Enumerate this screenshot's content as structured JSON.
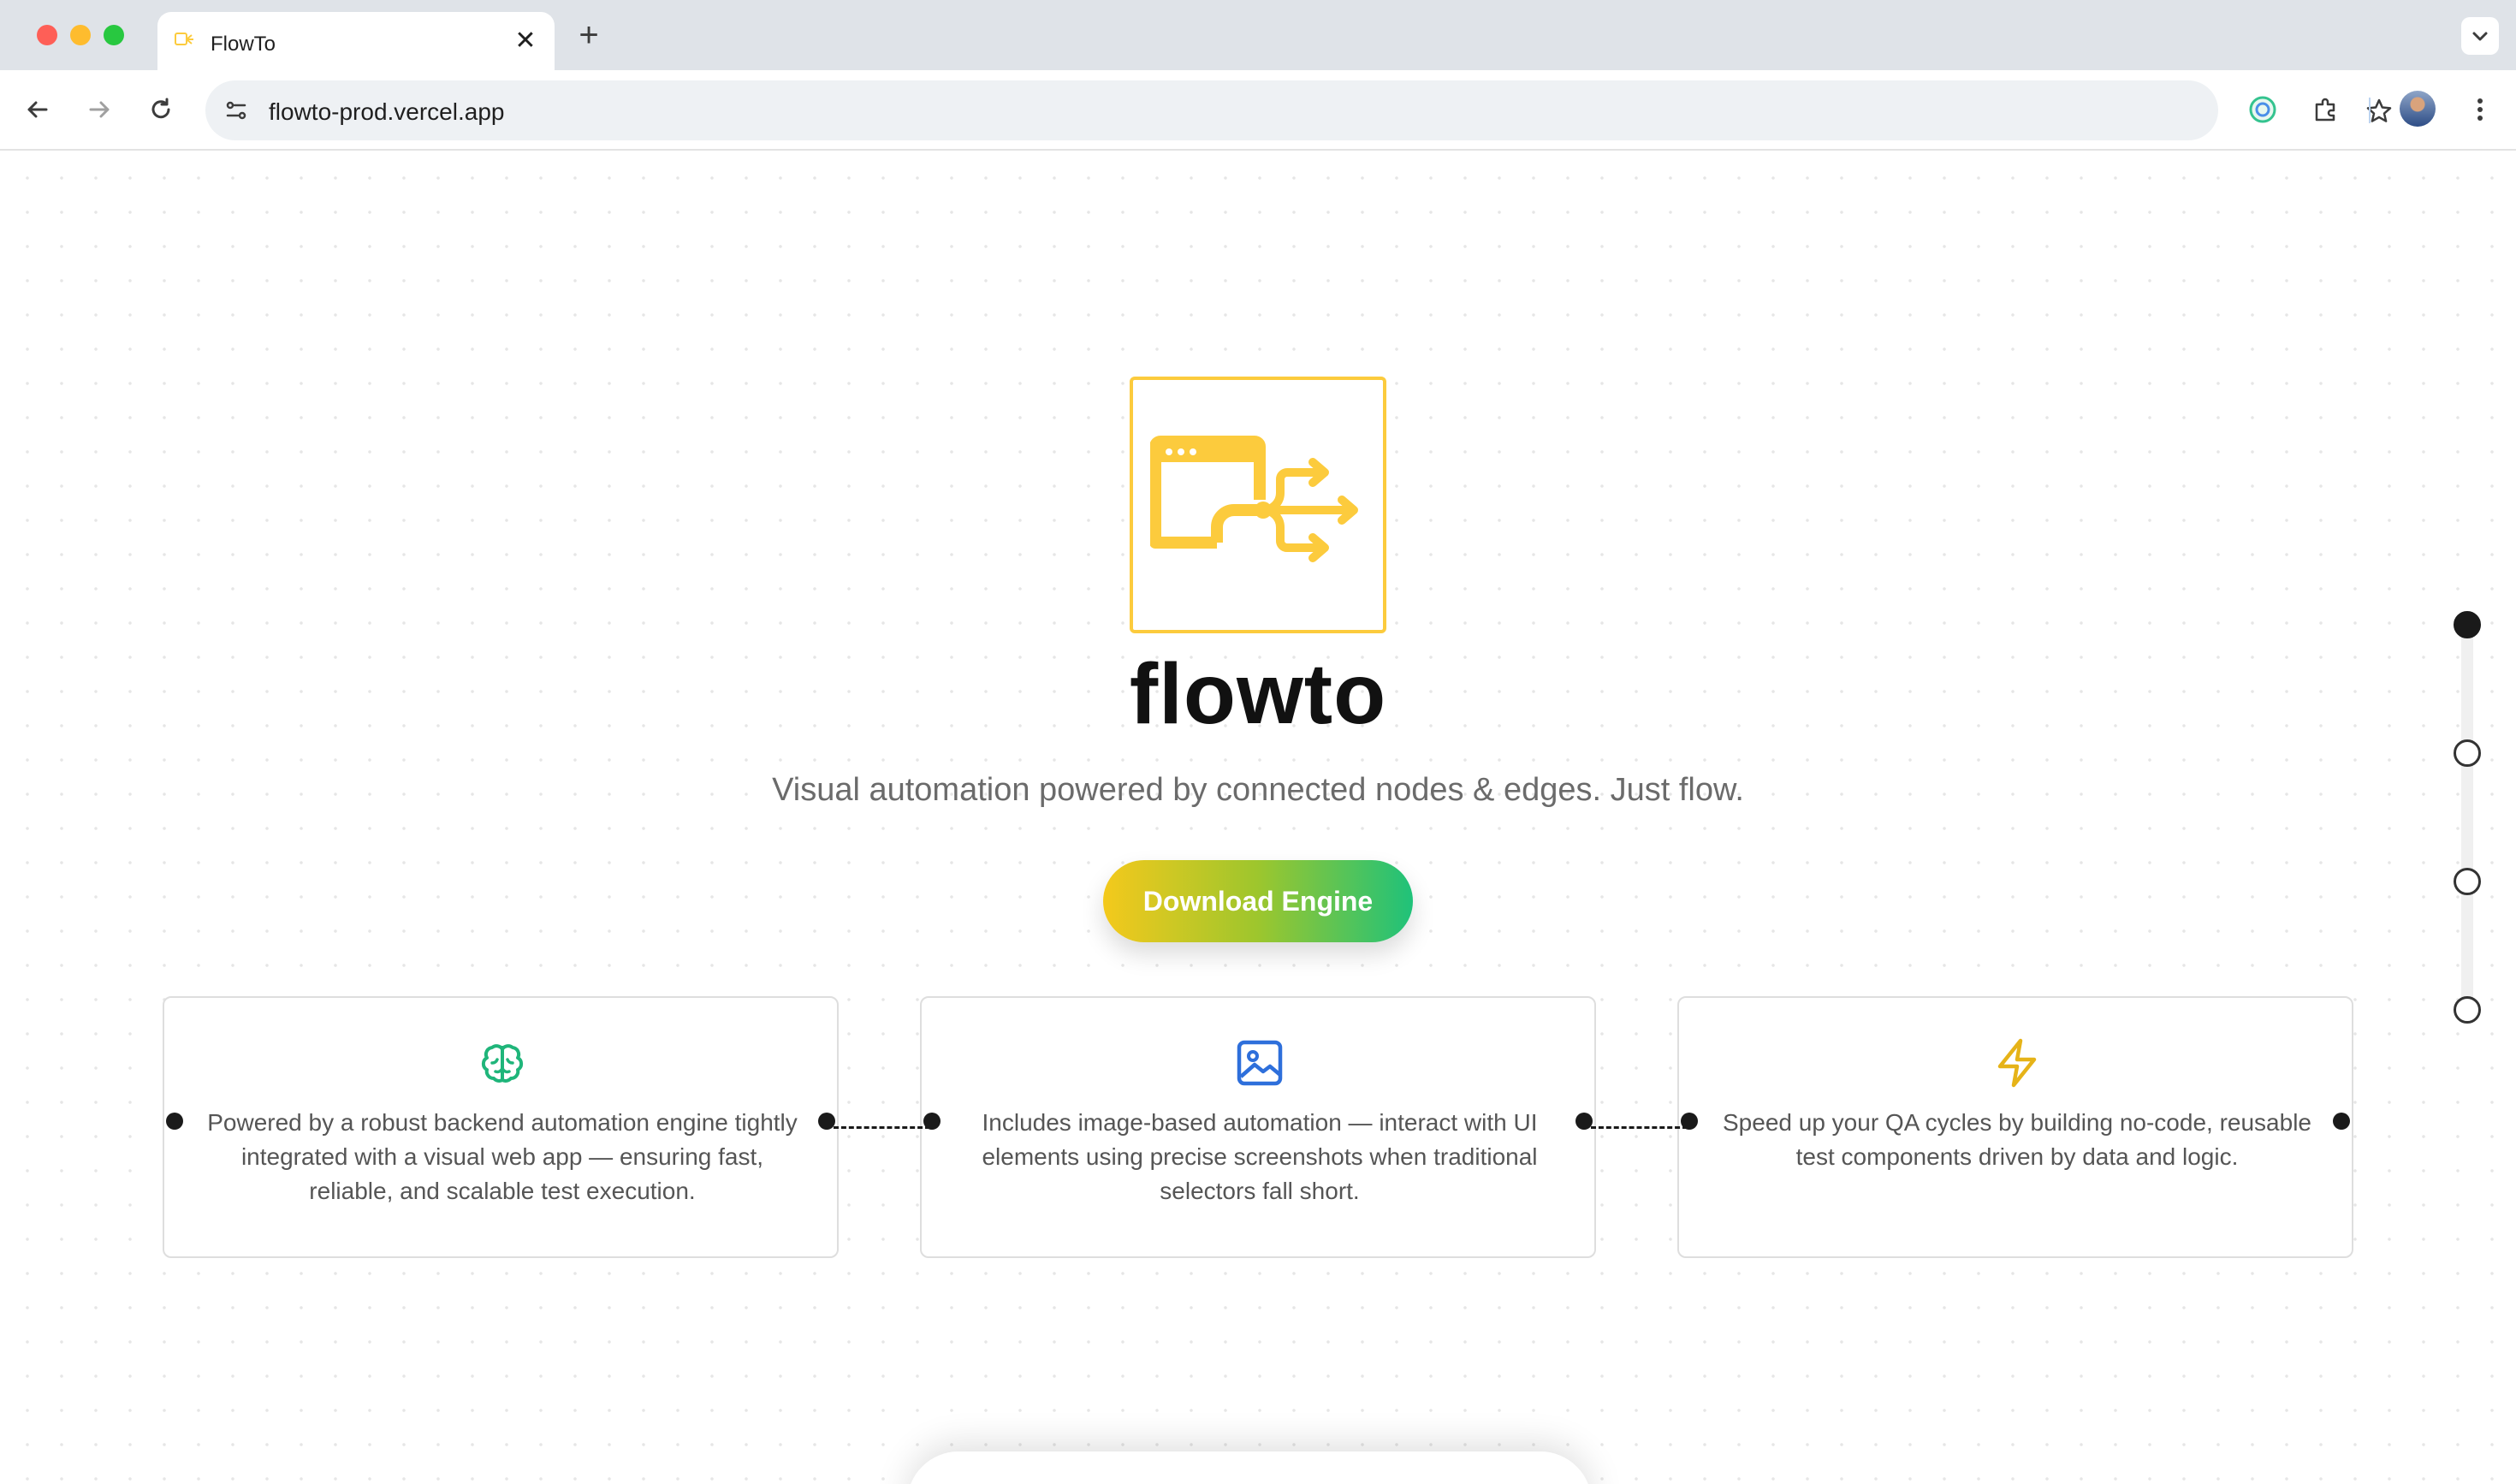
{
  "browser": {
    "tab_title": "FlowTo",
    "tab_close": "✕",
    "new_tab": "+",
    "url": "flowto-prod.vercel.app"
  },
  "hero": {
    "brand": "flowto",
    "tagline": "Visual automation powered by connected nodes & edges. Just flow.",
    "cta_label": "Download Engine"
  },
  "features": [
    {
      "icon": "brain-icon",
      "text": "Powered by a robust backend automation engine tightly integrated with a visual web app — ensuring fast, reliable, and scalable test execution."
    },
    {
      "icon": "image-icon",
      "text": "Includes image-based automation — interact with UI elements using precise screenshots when traditional selectors fall short."
    },
    {
      "icon": "lightning-icon",
      "text": "Speed up your QA cycles by building no-code, reusable test components driven by data and logic."
    }
  ],
  "section_nav": {
    "total": 4,
    "active": 1
  },
  "colors": {
    "brand_yellow": "#fccb3d",
    "green": "#1fc27a",
    "blue": "#2e6fdb",
    "amber": "#e6b318"
  }
}
